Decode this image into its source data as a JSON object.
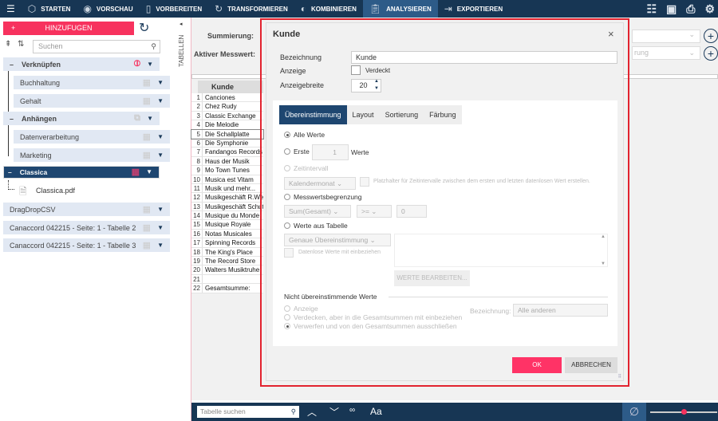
{
  "topbar": {
    "items": [
      {
        "label": "STARTEN",
        "icon": "cube-icon"
      },
      {
        "label": "VORSCHAU",
        "icon": "eye-icon"
      },
      {
        "label": "VORBEREITEN",
        "icon": "book-icon"
      },
      {
        "label": "TRANSFORMIEREN",
        "icon": "cycle-icon"
      },
      {
        "label": "KOMBINIEREN",
        "icon": "combine-icon"
      },
      {
        "label": "ANALYSIEREN",
        "icon": "clipboard-icon",
        "active": true
      },
      {
        "label": "EXPORTIEREN",
        "icon": "export-icon"
      }
    ]
  },
  "left": {
    "add_label": "HINZUFUGEN",
    "search_placeholder": "Suchen",
    "groups": [
      {
        "label": "Verknüpfen"
      },
      {
        "label": "Buchhaltung"
      },
      {
        "label": "Gehalt"
      },
      {
        "label": "Anhängen"
      },
      {
        "label": "Datenverarbeitung"
      },
      {
        "label": "Marketing"
      },
      {
        "label": "Classica"
      },
      {
        "label": "Classica.pdf"
      },
      {
        "label": "DragDropCSV"
      },
      {
        "label": "Canaccord 042215 - Seite: 1 - Tabelle 2"
      },
      {
        "label": "Canaccord 042215 - Seite: 1 - Tabelle 3"
      }
    ]
  },
  "tabellen_label": "TABELLEN",
  "main": {
    "summierung_label": "Summierung:",
    "messwert_label": "Aktiver Messwert:",
    "messwert_partial": "rung",
    "column_header": "Kunde",
    "rows": [
      "Canciones",
      "Chez Rudy",
      "Classic Exchange",
      "Die Melodie",
      "Die Schallplatte",
      "Die Symphonie",
      "Fandangos Records",
      "Haus der Musik",
      "Mo Town Tunes",
      "Musica est Vitam",
      "Musik und mehr...",
      "Musikgeschäft R.Wellen",
      "Musikgeschäft Schutz",
      "Musique du Monde",
      "Musique Royale",
      "Notas Musicales",
      "Spinning Records",
      "The King's Place",
      "The Record Store",
      "Walters Musiktruhe",
      "",
      "Gesamtsumme:"
    ]
  },
  "dialog": {
    "title": "Kunde",
    "bezeichnung_label": "Bezeichnung",
    "bezeichnung_value": "Kunde",
    "anzeige_label": "Anzeige",
    "verdeckt_label": "Verdeckt",
    "breite_label": "Anzeigebreite",
    "breite_value": "20",
    "tabs": [
      "Übereinstimmung",
      "Layout",
      "Sortierung",
      "Färbung"
    ],
    "alle_werte": "Alle Werte",
    "erste": "Erste",
    "erste_value": "1",
    "werte": "Werte",
    "zeitintervall": "Zeitintervall",
    "kalendermonat": "Kalendermonat",
    "platzhalter": "Platzhalter für Zeitintervalle zwischen dem ersten und letzten datenlosen Wert erstellen.",
    "messwertsbegrenzung": "Messwertsbegrenzung",
    "sum_gesamt": "Sum(Gesamt)",
    "operator": ">=",
    "limit_value": "0",
    "werte_aus_tabelle": "Werte aus Tabelle",
    "genaue": "Genaue Übereinstimmung",
    "datenlose": "Datenlose Werte mit einbeziehen",
    "werte_bearbeiten": "WERTE BEARBEITEN...",
    "nicht_header": "Nicht übereinstimmende Werte",
    "opt_anzeige": "Anzeige",
    "opt_verdecken": "Verdecken, aber in die Gesamtsummen mit einbeziehen",
    "opt_verwerfen": "Verwerfen und von den Gesamtsummen ausschließen",
    "bez_label": "Bezeichnung:",
    "bez_value": "Alle anderen",
    "ok": "OK",
    "cancel": "ABBRECHEN"
  },
  "bottom": {
    "search_placeholder": "Tabelle suchen",
    "font_label": "Aa",
    "slider_value": 0.5
  }
}
